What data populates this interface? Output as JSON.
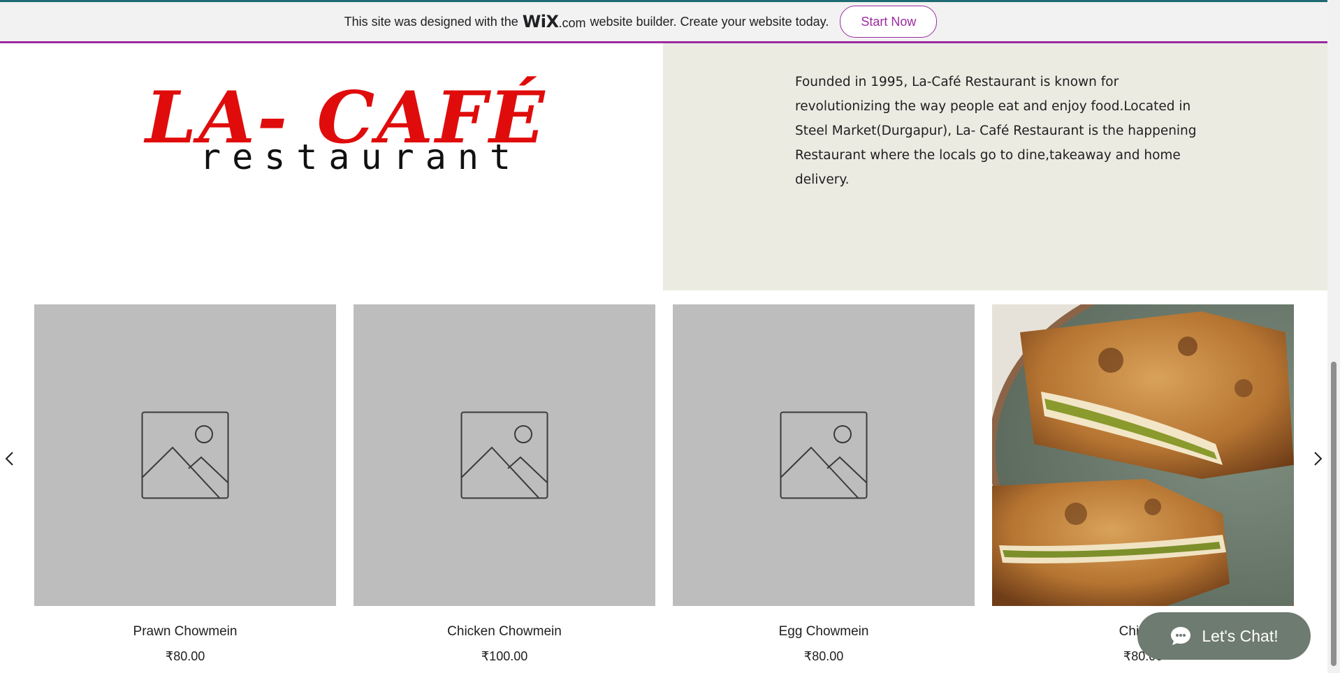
{
  "banner": {
    "pre_text": "This site was designed with the",
    "brand": "WiX",
    "brand_suffix": ".com",
    "post_text": "website builder. Create your website today.",
    "cta_label": "Start Now"
  },
  "logo": {
    "title": "LA- CAFÉ",
    "subtitle": "restaurant"
  },
  "about": {
    "text": "Founded in 1995, La-Café Restaurant is known for revolutionizing the way people eat and enjoy food.Located in Steel Market(Durgapur), La- Café Restaurant is the happening Restaurant where the locals go to dine,takeaway and home delivery."
  },
  "products": [
    {
      "name": "Prawn Chowmein",
      "price": "₹80.00",
      "image": "placeholder-icon"
    },
    {
      "name": "Chicken Chowmein",
      "price": "₹100.00",
      "image": "placeholder-icon"
    },
    {
      "name": "Egg Chowmein",
      "price": "₹80.00",
      "image": "placeholder-icon"
    },
    {
      "name": "Chicken",
      "price": "₹80.00",
      "image": "stuffed-paratha-photo"
    }
  ],
  "chat": {
    "label": "Let's Chat!",
    "icon": "chat-bubble-icon"
  },
  "colors": {
    "brand_red": "#e00c0c",
    "accent_purple": "#9b2b9f",
    "about_bg": "#ecebe2",
    "chat_bg": "#6e7b70",
    "placeholder_bg": "#bdbdbd"
  }
}
